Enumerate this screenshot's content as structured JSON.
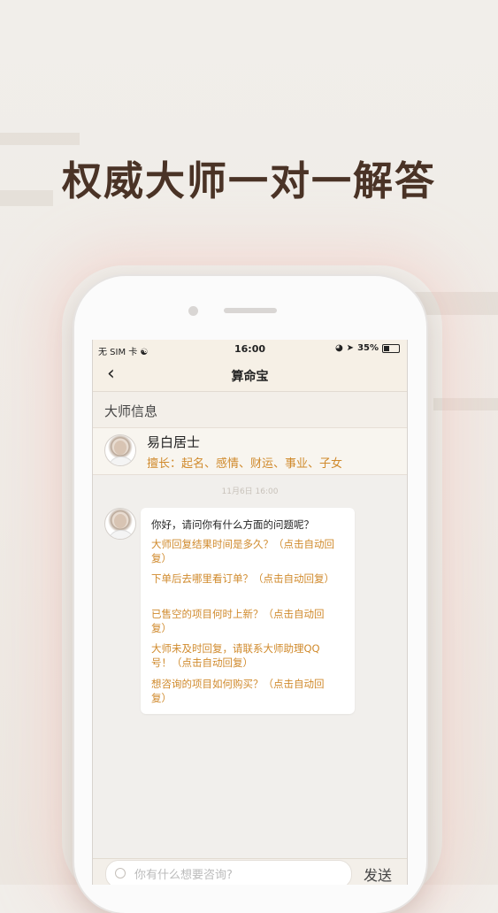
{
  "headline": "权威大师一对一解答",
  "status_bar": {
    "carrier": "无 SIM 卡",
    "time": "16:00",
    "battery": "35%",
    "battery_level": 0.35
  },
  "nav": {
    "back_icon": "chevron-left-icon",
    "title": "算命宝"
  },
  "section": {
    "label": "大师信息"
  },
  "master": {
    "name": "易白居士",
    "skills": "擅长：起名、感情、财运、事业、子女"
  },
  "chat": {
    "timestamp": "11月6日 16:00",
    "greeting": "你好，请问你有什么方面的问题呢？",
    "quick_questions": [
      "大师回复结果时间是多久？（点击自动回复）",
      "下单后去哪里看订单？（点击自动回复）",
      "已售空的项目何时上新？（点击自动回复）",
      "大师未及时回复，请联系大师助理QQ号！（点击自动回复）",
      "想咨询的项目如何购买？（点击自动回复）"
    ]
  },
  "input": {
    "placeholder": "你有什么想要咨询?",
    "send_label": "发送"
  },
  "colors": {
    "accent": "#d08a2c",
    "headline": "#4a3326",
    "background": "#f1eeea"
  }
}
